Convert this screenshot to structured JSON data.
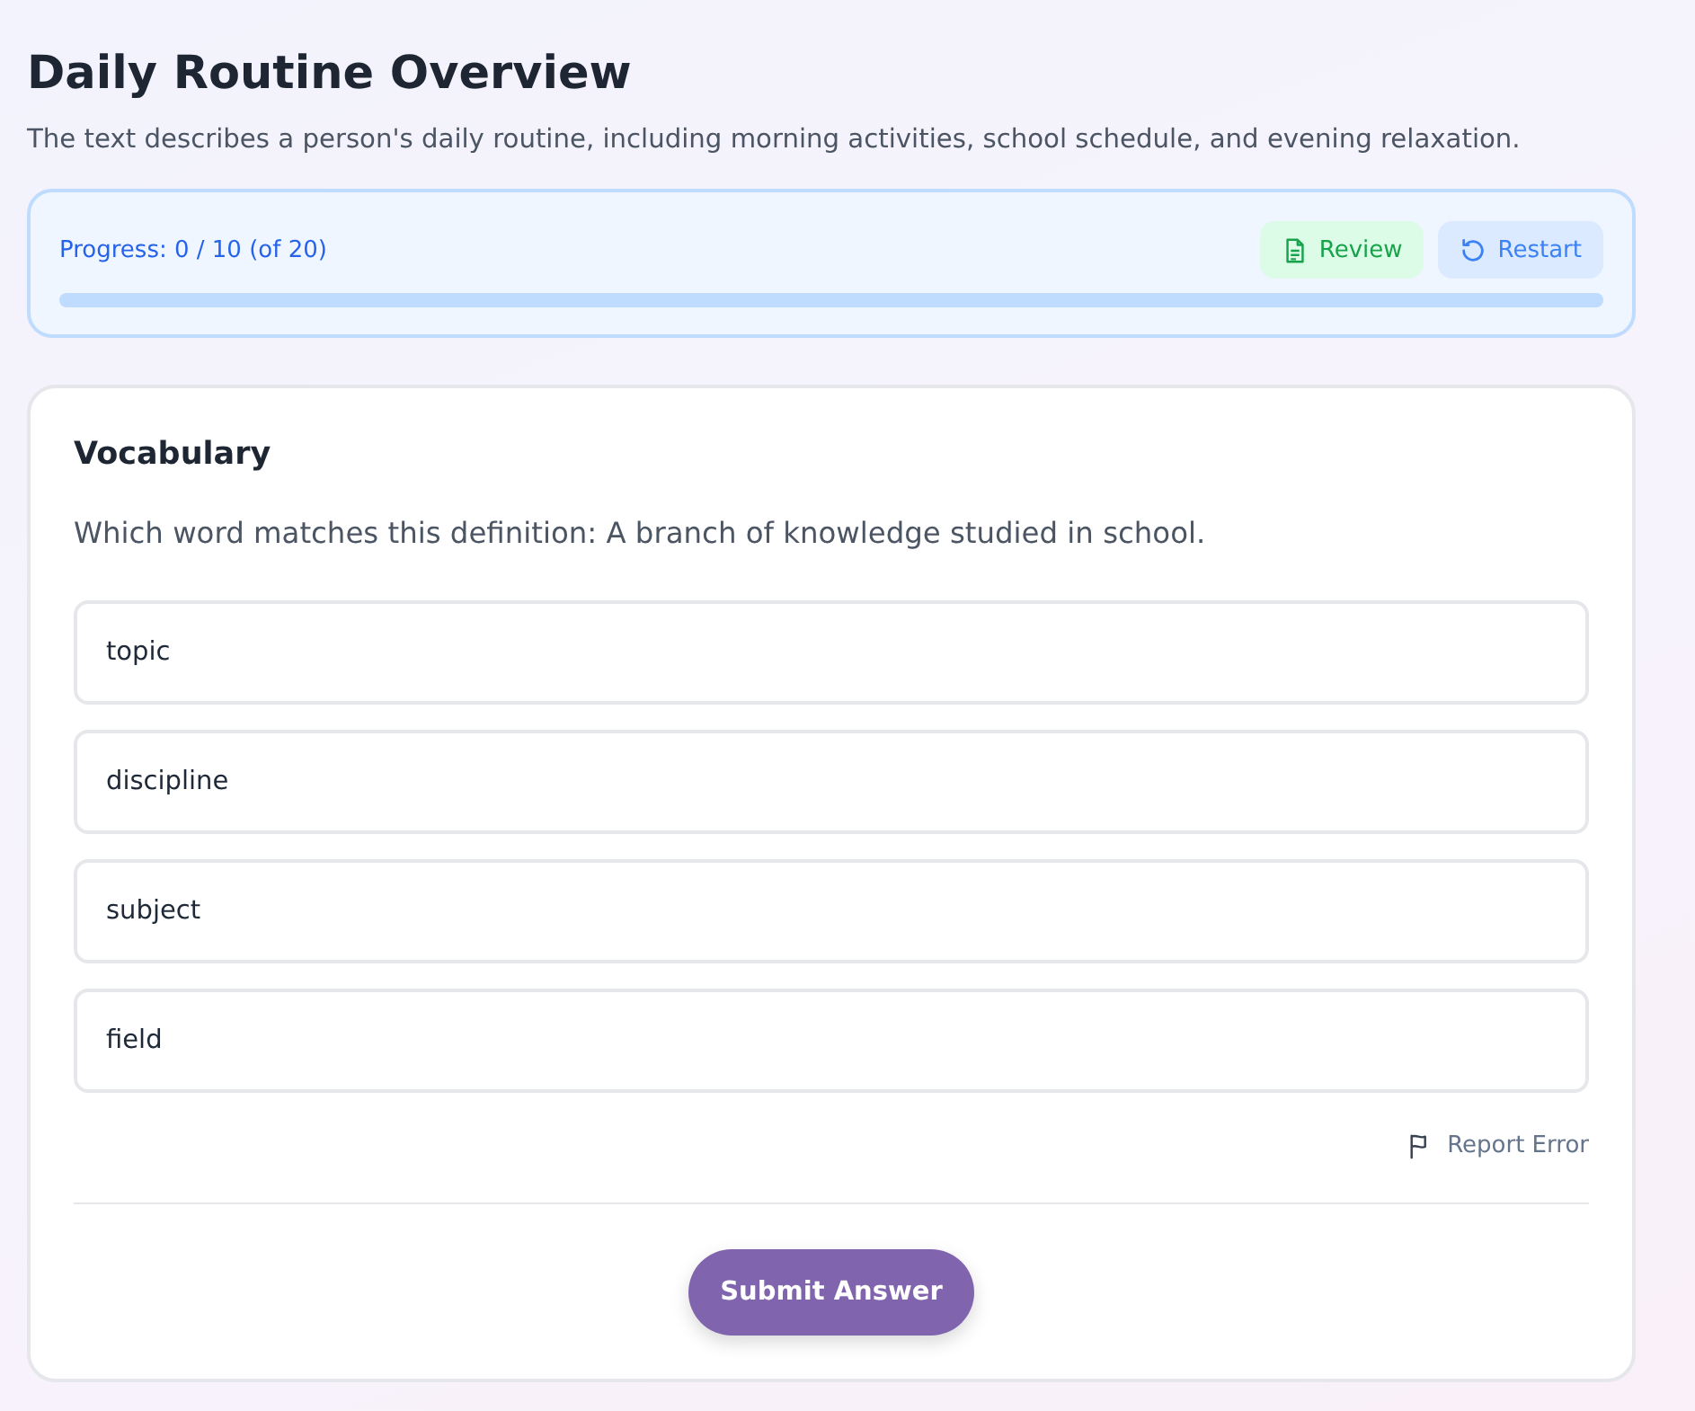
{
  "page": {
    "title": "Daily Routine Overview",
    "description": "The text describes a person's daily routine, including morning activities, school schedule, and evening relaxation."
  },
  "progress": {
    "label": "Progress: 0 / 10 (of 20)",
    "level": 0,
    "buttons": [
      {
        "kind": "review",
        "label": "Review"
      },
      {
        "kind": "restart",
        "label": "Restart"
      }
    ]
  },
  "question": {
    "category": "Vocabulary",
    "prompt": "Which word matches this definition: A branch of knowledge studied in school.",
    "options": [
      {
        "label": "topic",
        "selected": false
      },
      {
        "label": "discipline",
        "selected": false
      },
      {
        "label": "subject",
        "selected": false
      },
      {
        "label": "field",
        "selected": false
      }
    ],
    "report_link": "Report Error",
    "submit_button": "Submit Answer"
  }
}
